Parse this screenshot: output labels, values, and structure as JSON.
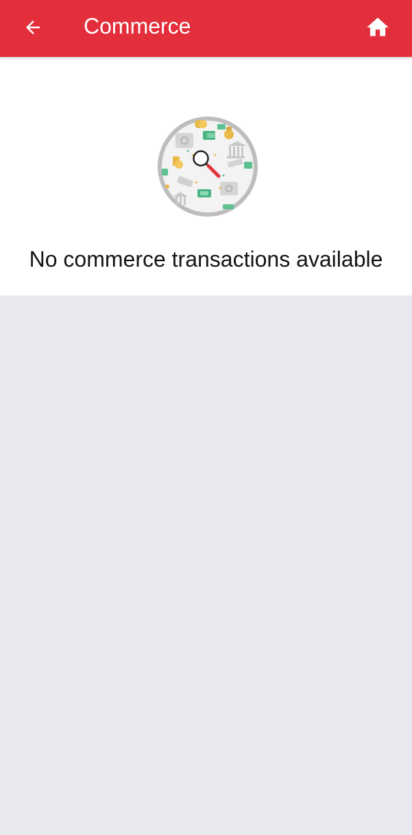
{
  "header": {
    "title": "Commerce",
    "back_icon": "arrow-left-icon",
    "home_icon": "home-icon"
  },
  "empty_state": {
    "illustration_icon": "magnifier-money-illustration",
    "message": "No commerce transactions available"
  },
  "colors": {
    "app_bar": "#e32e3b",
    "background": "#e7e9ee",
    "panel": "#ffffff",
    "text": "#141414"
  }
}
